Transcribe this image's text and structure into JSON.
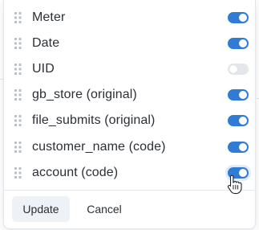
{
  "columns": [
    {
      "label": "Meter",
      "enabled": true
    },
    {
      "label": "Date",
      "enabled": true
    },
    {
      "label": "UID",
      "enabled": false
    },
    {
      "label": "gb_store (original)",
      "enabled": true
    },
    {
      "label": "file_submits (original)",
      "enabled": true
    },
    {
      "label": "customer_name (code)",
      "enabled": true
    },
    {
      "label": "account (code)",
      "enabled": true
    }
  ],
  "actions": {
    "update_label": "Update",
    "cancel_label": "Cancel"
  },
  "colors": {
    "toggle_on": "#2f7bd6",
    "toggle_off": "#e3e6eb",
    "grip": "#b9bec6",
    "text": "#2b2f36"
  },
  "icons": {
    "drag_handle": "drag-handle-icon",
    "cursor": "hand-pointer-icon"
  }
}
